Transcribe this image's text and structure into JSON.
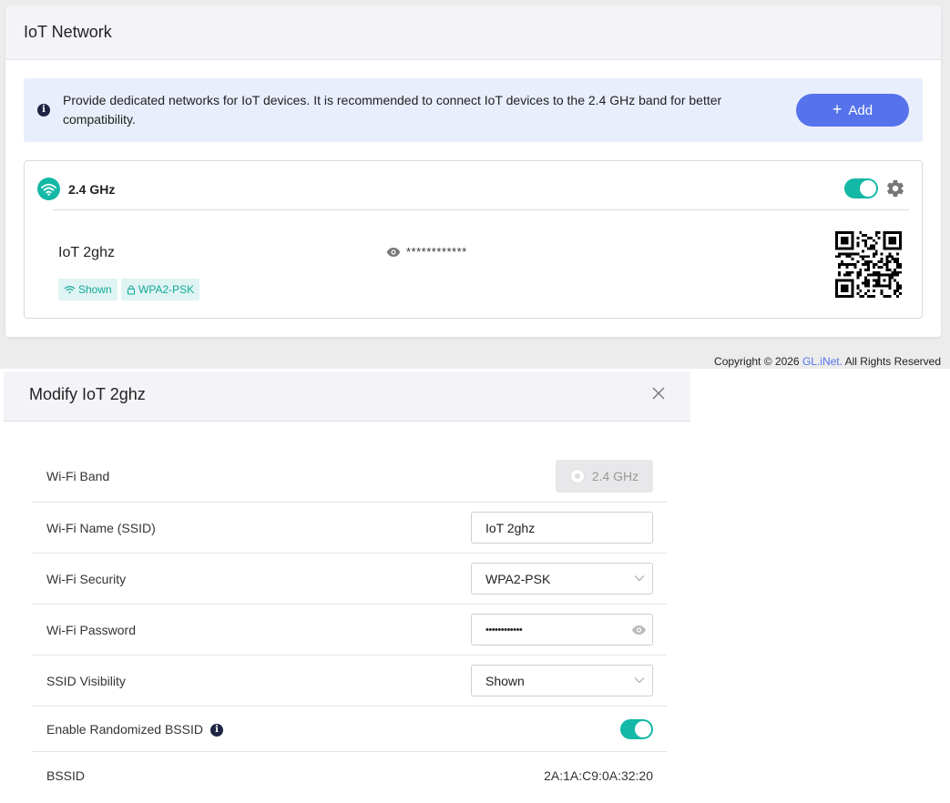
{
  "iot_card": {
    "title": "IoT Network",
    "notice": "Provide dedicated networks for IoT devices. It is recommended to connect IoT devices to the 2.4 GHz band for better compatibility.",
    "add_label": "Add",
    "band": {
      "label": "2.4 GHz",
      "enabled": true,
      "ssid": "IoT 2ghz",
      "password_mask": "************",
      "tags": [
        "Shown",
        "WPA2-PSK"
      ]
    }
  },
  "footer": {
    "copyright_prefix": "Copyright © 2026",
    "brand": "GL.iNet.",
    "copyright_suffix": "All Rights Reserved"
  },
  "modal": {
    "title": "Modify IoT 2ghz",
    "rows": {
      "band": {
        "label": "Wi-Fi Band",
        "value": "2.4 GHz"
      },
      "ssid": {
        "label": "Wi-Fi Name (SSID)",
        "value": "IoT 2ghz"
      },
      "security": {
        "label": "Wi-Fi Security",
        "value": "WPA2-PSK"
      },
      "password": {
        "label": "Wi-Fi Password",
        "value": "••••••••••••"
      },
      "visibility": {
        "label": "SSID Visibility",
        "value": "Shown"
      },
      "randomized": {
        "label": "Enable Randomized BSSID",
        "enabled": true
      },
      "bssid": {
        "label": "BSSID",
        "value": "2A:1A:C9:0A:32:20"
      }
    }
  },
  "colors": {
    "accent_teal": "#13b8a6",
    "accent_blue": "#5673ec",
    "notice_bg": "#e9eefc",
    "info_icon": "#1f2344"
  },
  "icons": [
    "info-icon",
    "plus-icon",
    "wifi-icon",
    "gear-icon",
    "eye-icon",
    "lock-icon",
    "qr-code",
    "close-icon",
    "chevron-down-icon"
  ]
}
